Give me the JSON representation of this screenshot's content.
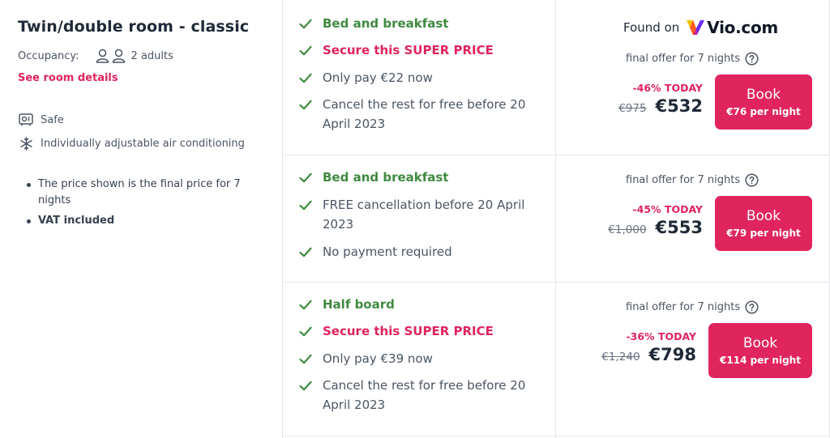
{
  "room": {
    "title": "Twin/double room - classic",
    "occupancy_label": "Occupancy:",
    "adults": "2 adults",
    "details_link": "See room details",
    "amenities": [
      {
        "label": "Safe",
        "icon": "safe-icon"
      },
      {
        "label": "Individually adjustable air conditioning",
        "icon": "snowflake-icon"
      }
    ],
    "notes": [
      "The price shown is the final price for 7 nights",
      "VAT included"
    ]
  },
  "found_on": {
    "label": "Found on",
    "provider": "Vio.com"
  },
  "offers": [
    {
      "features": [
        {
          "text": "Bed and breakfast",
          "style": "green"
        },
        {
          "text": "Secure this SUPER PRICE",
          "style": "red"
        },
        {
          "text": "Only pay €22 now",
          "style": "normal"
        },
        {
          "text": "Cancel the rest for free before 20 April 2023",
          "style": "normal"
        }
      ],
      "final_offer": "final offer for 7 nights",
      "discount": "-46% TODAY",
      "old_price": "€975",
      "new_price": "€532",
      "book_label": "Book",
      "per_night": "€76 per night"
    },
    {
      "features": [
        {
          "text": "Bed and breakfast",
          "style": "green"
        },
        {
          "text": "FREE cancellation before 20 April 2023",
          "style": "normal"
        },
        {
          "text": "No payment required",
          "style": "normal"
        }
      ],
      "final_offer": "final offer for 7 nights",
      "discount": "-45% TODAY",
      "old_price": "€1,000",
      "new_price": "€553",
      "book_label": "Book",
      "per_night": "€79 per night"
    },
    {
      "features": [
        {
          "text": "Half board",
          "style": "green"
        },
        {
          "text": "Secure this SUPER PRICE",
          "style": "red"
        },
        {
          "text": "Only pay €39 now",
          "style": "normal"
        },
        {
          "text": "Cancel the rest for free before 20 April 2023",
          "style": "normal"
        }
      ],
      "final_offer": "final offer for 7 nights",
      "discount": "-36% TODAY",
      "old_price": "€1,240",
      "new_price": "€798",
      "book_label": "Book",
      "per_night": "€114 per night"
    }
  ],
  "colors": {
    "accent": "#e0245e",
    "green": "#3f8a3f",
    "text": "#1f2937"
  }
}
